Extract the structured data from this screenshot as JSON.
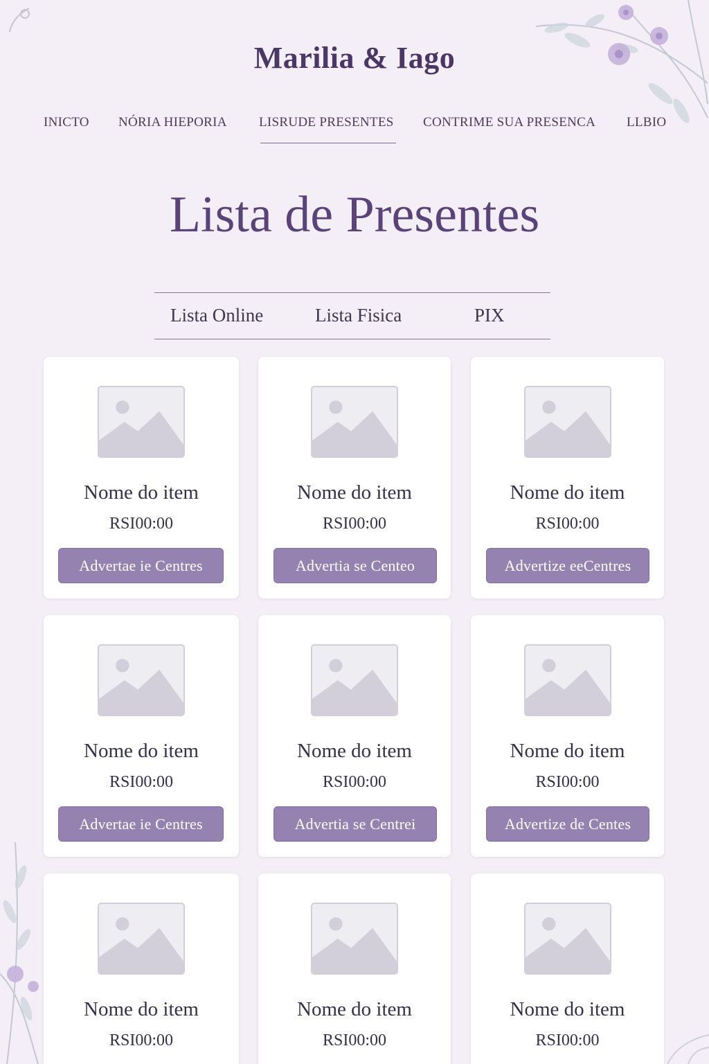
{
  "site": {
    "title": "Marilia & Iago"
  },
  "nav": {
    "items": [
      {
        "label": "INICTO"
      },
      {
        "label": "NÓRIA HIEPORIA"
      },
      {
        "label": "LISRUDE PRESENTES",
        "active": true
      },
      {
        "label": "CONTRIME SUA PRESENCA"
      },
      {
        "label": "LLBIO"
      }
    ]
  },
  "main": {
    "heading": "Lista de Presentes",
    "tabs": [
      {
        "label": "Lista Online"
      },
      {
        "label": "Lista Fisica"
      },
      {
        "label": "PIX"
      }
    ],
    "items": [
      {
        "name": "Nome do item",
        "price": "RSI00:00",
        "button": "Advertae ie Centres"
      },
      {
        "name": "Nome do item",
        "price": "RSI00:00",
        "button": "Advertia se Centeo"
      },
      {
        "name": "Nome do item",
        "price": "RSI00:00",
        "button": "Advertize eeCentres"
      },
      {
        "name": "Nome do item",
        "price": "RSI00:00",
        "button": "Advertae ie Centres"
      },
      {
        "name": "Nome do item",
        "price": "RSI00:00",
        "button": "Advertia se Centrei"
      },
      {
        "name": "Nome do item",
        "price": "RSI00:00",
        "button": "Advertize de Centes"
      },
      {
        "name": "Nome do item",
        "price": "RSI00:00",
        "button": ""
      },
      {
        "name": "Nome do item",
        "price": "RSI00:00",
        "button": ""
      },
      {
        "name": "Nome do item",
        "price": "RSI00:00",
        "button": ""
      }
    ]
  },
  "colors": {
    "background": "#f4eef6",
    "accent": "#9682b1",
    "heading": "#5a4378",
    "card": "#ffffff",
    "placeholder": "#d2cfdb"
  },
  "icons": {
    "item_image": "image-placeholder-icon",
    "decoration": "floral-decoration-icon"
  }
}
